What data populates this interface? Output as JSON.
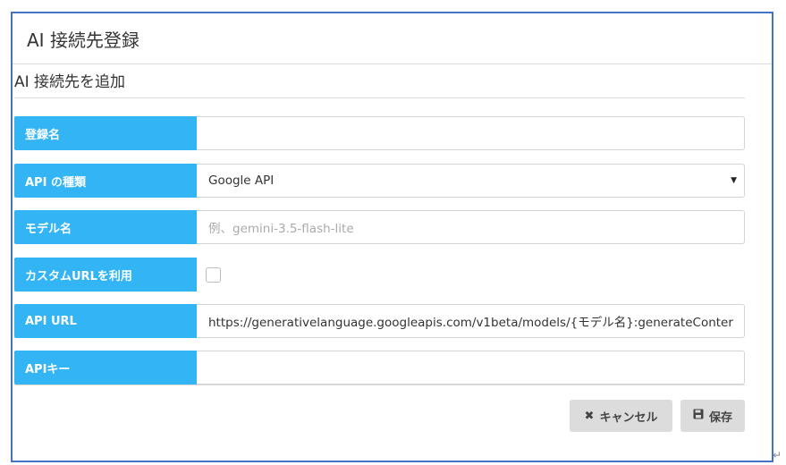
{
  "dialog": {
    "title": "AI 接続先登録",
    "section_heading": "AI 接続先を追加"
  },
  "form": {
    "registration_name": {
      "label": "登録名",
      "value": ""
    },
    "api_type": {
      "label": "API の種類",
      "value": "Google API"
    },
    "model_name": {
      "label": "モデル名",
      "placeholder": "例、gemini-3.5-flash-lite"
    },
    "custom_url": {
      "label": "カスタムURLを利用",
      "checked": false
    },
    "api_url": {
      "label": "API URL",
      "value": "https://generativelanguage.googleapis.com/v1beta/models/{モデル名}:generateConter"
    },
    "api_key": {
      "label": "APIキー",
      "value": ""
    }
  },
  "buttons": {
    "cancel_label": "キャンセル",
    "save_label": "保存"
  },
  "icons": {
    "cancel": "close-icon",
    "save": "floppy-disk-icon",
    "select": "caret-down-icon"
  },
  "colors": {
    "label_bg": "#33b5f5",
    "dialog_border": "#4472c4",
    "button_bg": "#dcdcdc"
  }
}
